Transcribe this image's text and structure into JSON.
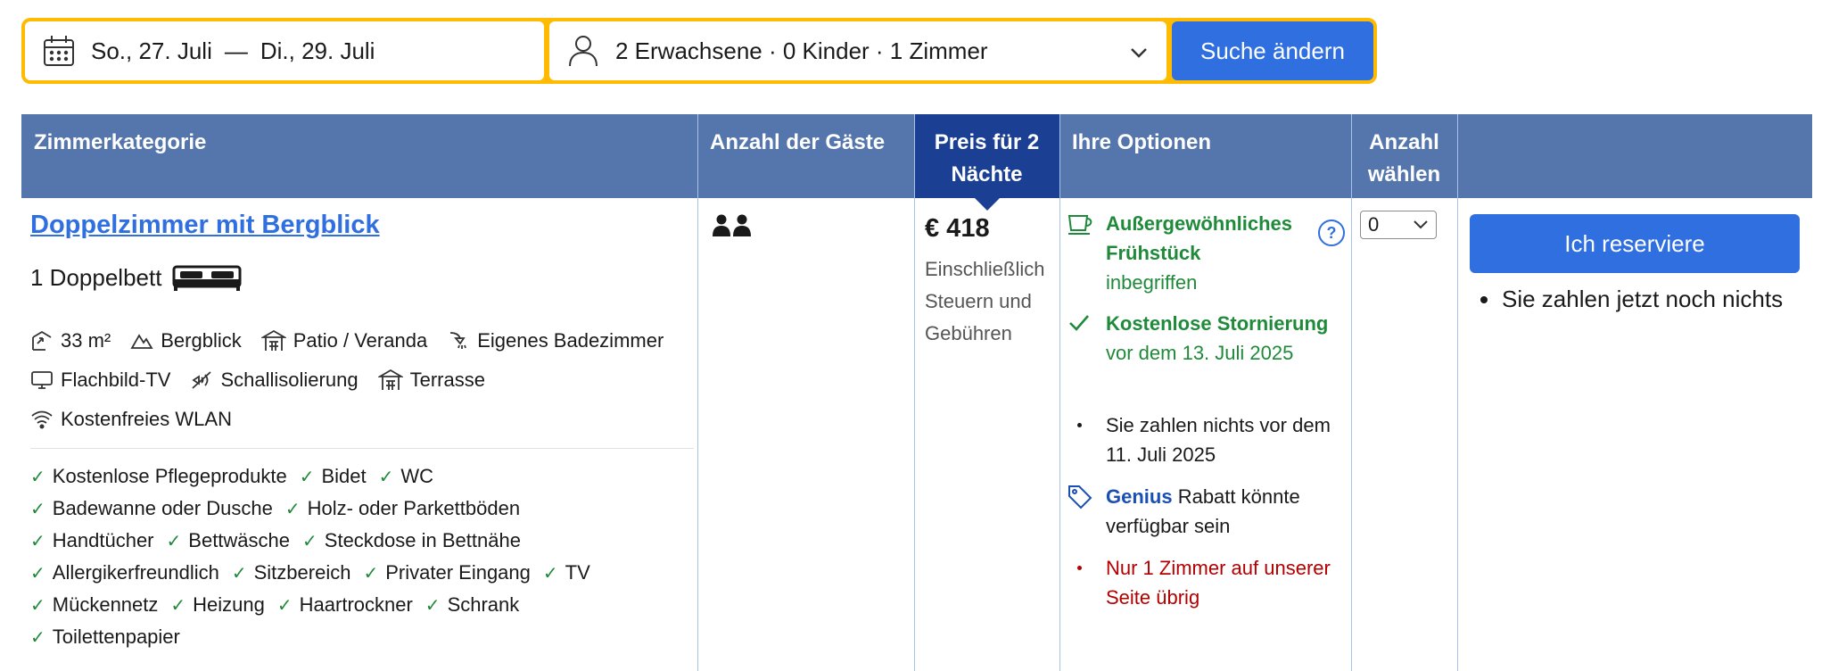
{
  "search": {
    "date_from": "So., 27. Juli",
    "date_sep": "—",
    "date_to": "Di., 29. Juli",
    "guests": "2 Erwachsene · 0 Kinder · 1 Zimmer",
    "button": "Suche ändern"
  },
  "table": {
    "headers": {
      "room": "Zimmerkategorie",
      "guests": "Anzahl der Gäste",
      "price_line1": "Preis für 2",
      "price_line2": "Nächte",
      "options": "Ihre Optionen",
      "qty_line1": "Anzahl",
      "qty_line2": "wählen"
    }
  },
  "room": {
    "title": "Doppelzimmer mit Bergblick",
    "bed": "1 Doppelbett",
    "facilities": {
      "size": "33 m²",
      "view": "Bergblick",
      "patio": "Patio / Veranda",
      "bath": "Eigenes Badezimmer",
      "tv": "Flachbild-TV",
      "soundproof": "Schallisolierung",
      "terrace": "Terrasse",
      "wifi": "Kostenfreies WLAN"
    },
    "amenities": [
      [
        "Kostenlose Pflegeprodukte",
        "Bidet",
        "WC"
      ],
      [
        "Badewanne oder Dusche",
        "Holz- oder Parkettböden"
      ],
      [
        "Handtücher",
        "Bettwäsche",
        "Steckdose in Bettnähe"
      ],
      [
        "Allergikerfreundlich",
        "Sitzbereich",
        "Privater Eingang",
        "TV"
      ],
      [
        "Mückennetz",
        "Heizung",
        "Haartrockner",
        "Schrank"
      ],
      [
        "Toilettenpapier"
      ]
    ]
  },
  "price": {
    "amount": "€ 418",
    "note": "Einschließlich Steuern und Gebühren"
  },
  "options": {
    "breakfast_bold": "Außergewöhnliches Frühstück",
    "breakfast_rest": "inbegriffen",
    "help": "?",
    "cancel_bold": "Kostenlose Stornierung",
    "cancel_rest": "vor dem 13. Juli 2025",
    "pay_later": "Sie zahlen nichts vor dem 11. Juli 2025",
    "genius_brand": "Genius",
    "genius_rest": "Rabatt könnte verfügbar sein",
    "scarcity": "Nur 1 Zimmer auf unserer Seite übrig"
  },
  "quantity": {
    "selected": "0"
  },
  "reserve": {
    "button": "Ich reserviere",
    "note": "Sie zahlen jetzt noch nichts"
  },
  "colors": {
    "header_bg": "#5575ad",
    "price_header_bg": "#1b3f93",
    "primary_button": "#2f6fe0",
    "searchbar_border": "#febb02",
    "green": "#1f8a3a",
    "red": "#b30000"
  }
}
